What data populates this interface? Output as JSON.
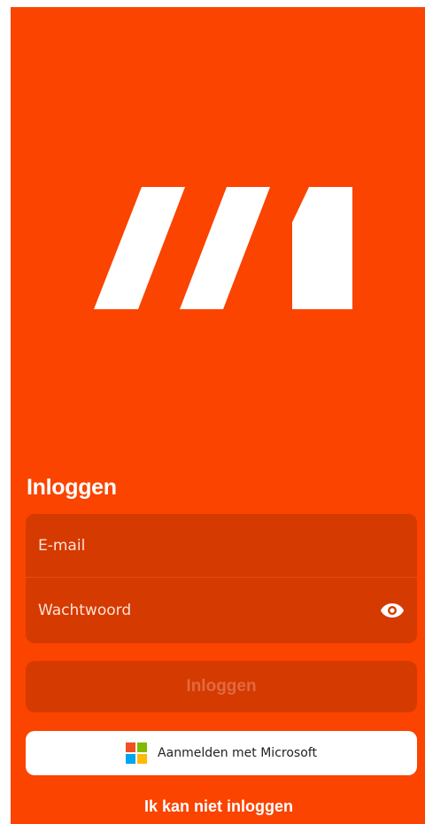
{
  "app": {
    "brand_color": "#FA4400",
    "field_bg_color": "#D53A00"
  },
  "logo": {
    "icon": "brand-logo-icon"
  },
  "login": {
    "title": "Inloggen",
    "email_placeholder": "E-mail",
    "email_value": "",
    "password_placeholder": "Wachtwoord",
    "password_value": "",
    "toggle_visibility_icon": "eye-icon",
    "submit_label": "Inloggen",
    "microsoft_label": "Aanmelden met Microsoft",
    "microsoft_icon": "microsoft-logo-icon",
    "microsoft_colors": [
      "#F25022",
      "#7FBA00",
      "#00A4EF",
      "#FFB900"
    ],
    "cant_login_label": "Ik kan niet inloggen"
  }
}
